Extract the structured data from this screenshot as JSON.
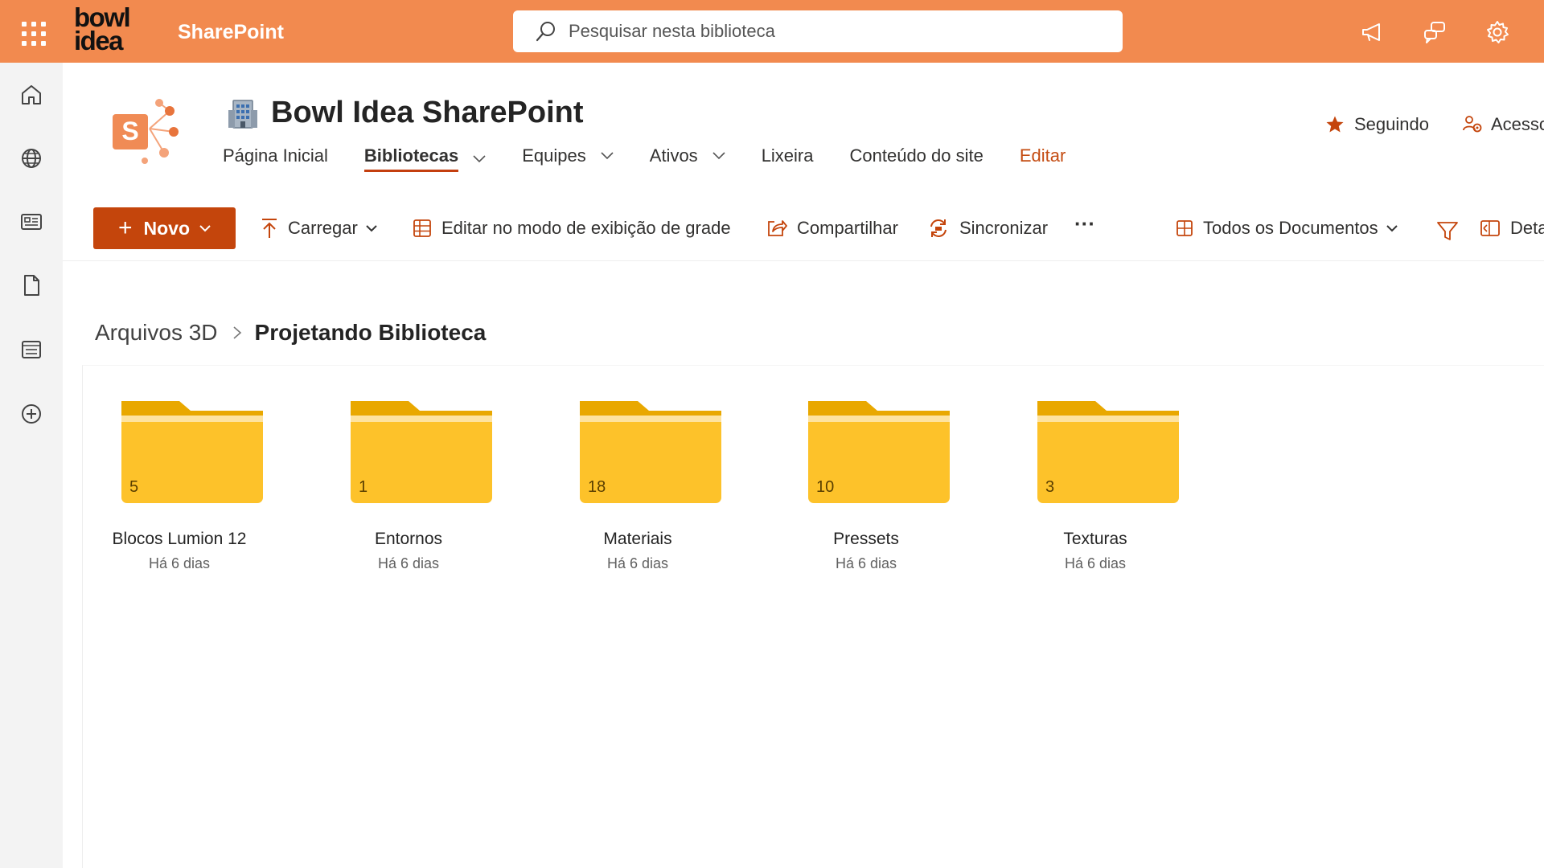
{
  "topbar": {
    "brand_line1": "bowl",
    "brand_line2": "idea",
    "app_name": "SharePoint",
    "search_placeholder": "Pesquisar nesta biblioteca",
    "icons": [
      "waffle-icon",
      "megaphone-icon",
      "chat-icon",
      "gear-icon"
    ],
    "color": "#f28a4f"
  },
  "rail": {
    "icons": [
      "home-icon",
      "globe-icon",
      "news-icon",
      "document-icon",
      "list-icon",
      "add-circle-icon"
    ]
  },
  "site": {
    "title": "Bowl Idea SharePoint",
    "nav": [
      {
        "label": "Página Inicial",
        "dropdown": false,
        "active": false
      },
      {
        "label": "Bibliotecas",
        "dropdown": true,
        "active": true
      },
      {
        "label": "Equipes",
        "dropdown": true,
        "active": false
      },
      {
        "label": "Ativos",
        "dropdown": true,
        "active": false
      },
      {
        "label": "Lixeira",
        "dropdown": false,
        "active": false
      },
      {
        "label": "Conteúdo do site",
        "dropdown": false,
        "active": false
      },
      {
        "label": "Editar",
        "dropdown": false,
        "active": false
      }
    ],
    "follow_label": "Seguindo",
    "access_label": "Acesso"
  },
  "commands": {
    "new_label": "Novo",
    "upload_label": "Carregar",
    "grid_edit_label": "Editar no modo de exibição de grade",
    "share_label": "Compartilhar",
    "sync_label": "Sincronizar",
    "more_label": "···",
    "view_label": "Todos os Documentos",
    "details_label": "Detalhes",
    "accent_color": "#c4450c"
  },
  "breadcrumb": {
    "parent": "Arquivos 3D",
    "current": "Projetando Biblioteca"
  },
  "folders": [
    {
      "name": "Blocos Lumion 12",
      "count": "5",
      "modified": "Há 6 dias"
    },
    {
      "name": "Entornos",
      "count": "1",
      "modified": "Há 6 dias"
    },
    {
      "name": "Materiais",
      "count": "18",
      "modified": "Há 6 dias"
    },
    {
      "name": "Pressets",
      "count": "10",
      "modified": "Há 6 dias"
    },
    {
      "name": "Texturas",
      "count": "3",
      "modified": "Há 6 dias"
    }
  ]
}
